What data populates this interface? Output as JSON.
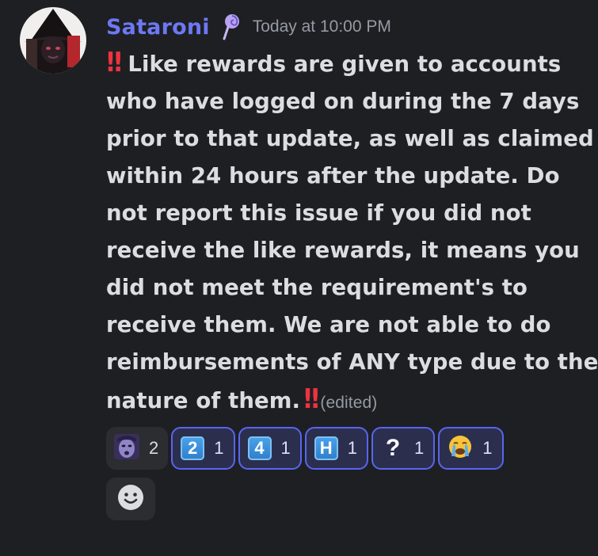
{
  "message": {
    "author": "Sataroni",
    "timestamp": "Today at 10:00 PM",
    "edited_label": "(edited)",
    "lead_marker": "‼",
    "trail_marker": "‼",
    "lines": [
      "Like rewards are given to accounts",
      "who have logged on during the 7 days",
      "prior to that update, as well as claimed",
      "within 24 hours after the update. Do",
      "not report this issue if you did not",
      "receive the like rewards, it means you",
      "did not meet the requirement's to",
      "receive them. We are not able to do",
      "reimbursements of ANY type due to the",
      "nature of them."
    ]
  },
  "reactions": [
    {
      "emoji": "custom-face",
      "count": "2",
      "me": false
    },
    {
      "emoji": "keycap",
      "symbol": "2",
      "count": "1",
      "me": true
    },
    {
      "emoji": "keycap",
      "symbol": "4",
      "count": "1",
      "me": true
    },
    {
      "emoji": "keycap",
      "symbol": "H",
      "count": "1",
      "me": true
    },
    {
      "emoji": "question",
      "symbol": "?",
      "count": "1",
      "me": true
    },
    {
      "emoji": "crying-face",
      "count": "1",
      "me": true
    }
  ],
  "colors": {
    "background": "#1e1f22",
    "username": "#6d78f3",
    "marker": "#ef3340",
    "reaction_active_border": "#5865f2",
    "keycap": "#3b92dc"
  },
  "icons": {
    "role_icon": "lollipop-icon",
    "add_reaction": "add-reaction-smiley-icon"
  }
}
